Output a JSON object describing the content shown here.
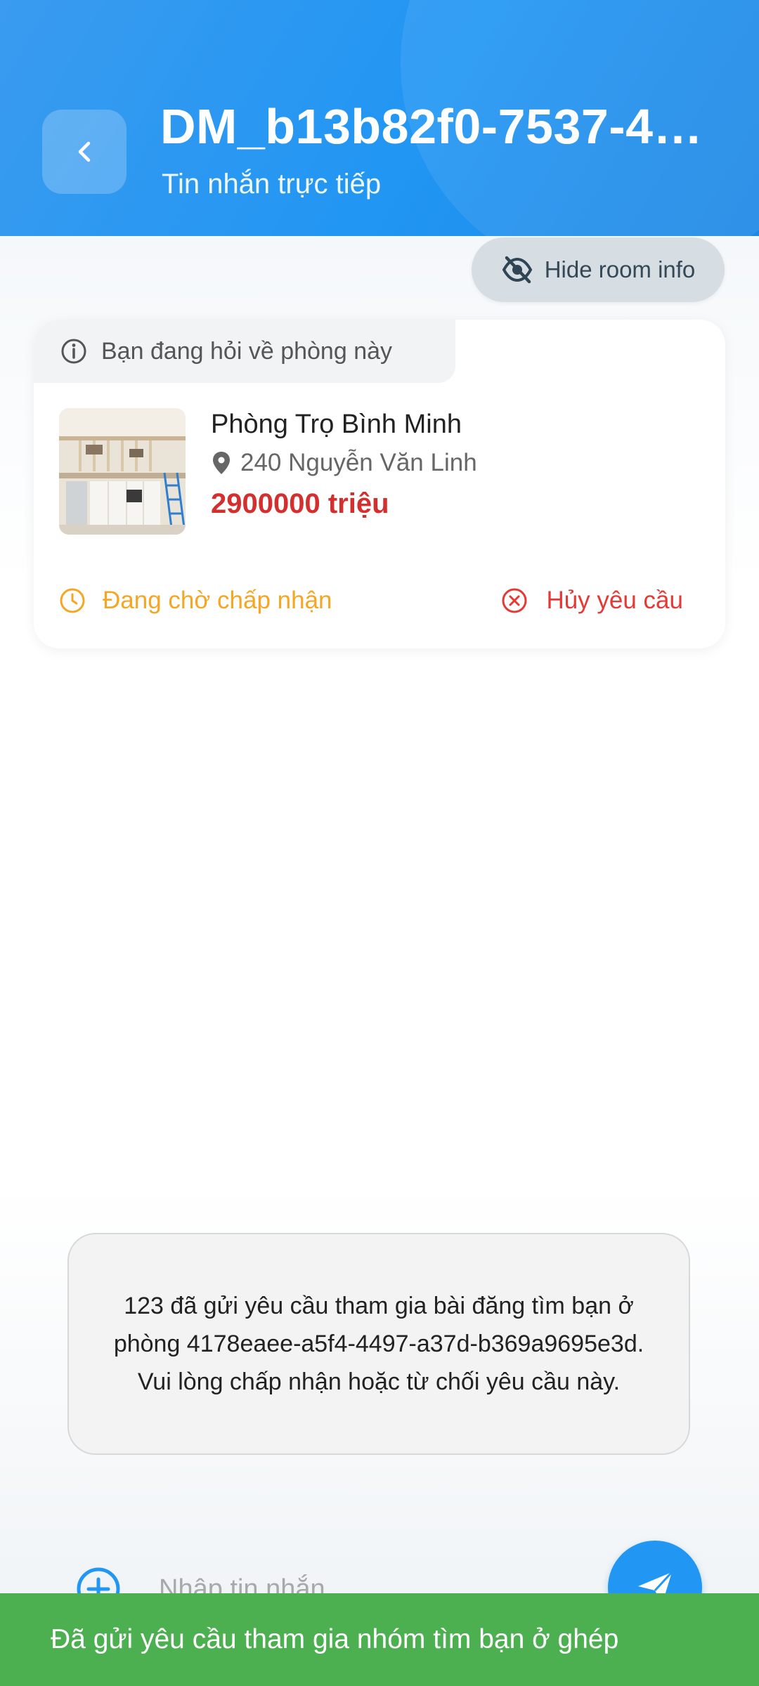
{
  "header": {
    "title": "DM_b13b82f0-7537-4…",
    "subtitle": "Tin nhắn trực tiếp"
  },
  "room_info_toggle": {
    "label": "Hide room info"
  },
  "room_card": {
    "tag": "Bạn đang hỏi về phòng này",
    "name": "Phòng Trọ Bình Minh",
    "address": "240 Nguyễn Văn Linh",
    "price": "2900000 triệu",
    "status": "Đang chờ chấp nhận",
    "cancel_label": "Hủy yêu cầu"
  },
  "system_message": "123 đã gửi yêu cầu tham gia bài đăng tìm bạn ở phòng 4178eaee-a5f4-4497-a37d-b369a9695e3d. Vui lòng chấp nhận hoặc từ chối yêu cầu này.",
  "composer": {
    "placeholder": "Nhập tin nhắn"
  },
  "snackbar": {
    "text": "Đã gửi yêu cầu tham gia nhóm tìm bạn ở ghép"
  },
  "colors": {
    "header_blue": "#2196f3",
    "price_red": "#d32f2f",
    "pending_orange": "#f5a623",
    "cancel_red": "#e53935",
    "snackbar_green": "#4caf50"
  },
  "icons": [
    "back-arrow-icon",
    "eye-off-icon",
    "info-icon",
    "location-pin-icon",
    "clock-icon",
    "cancel-circle-icon",
    "add-circle-icon",
    "send-icon"
  ]
}
